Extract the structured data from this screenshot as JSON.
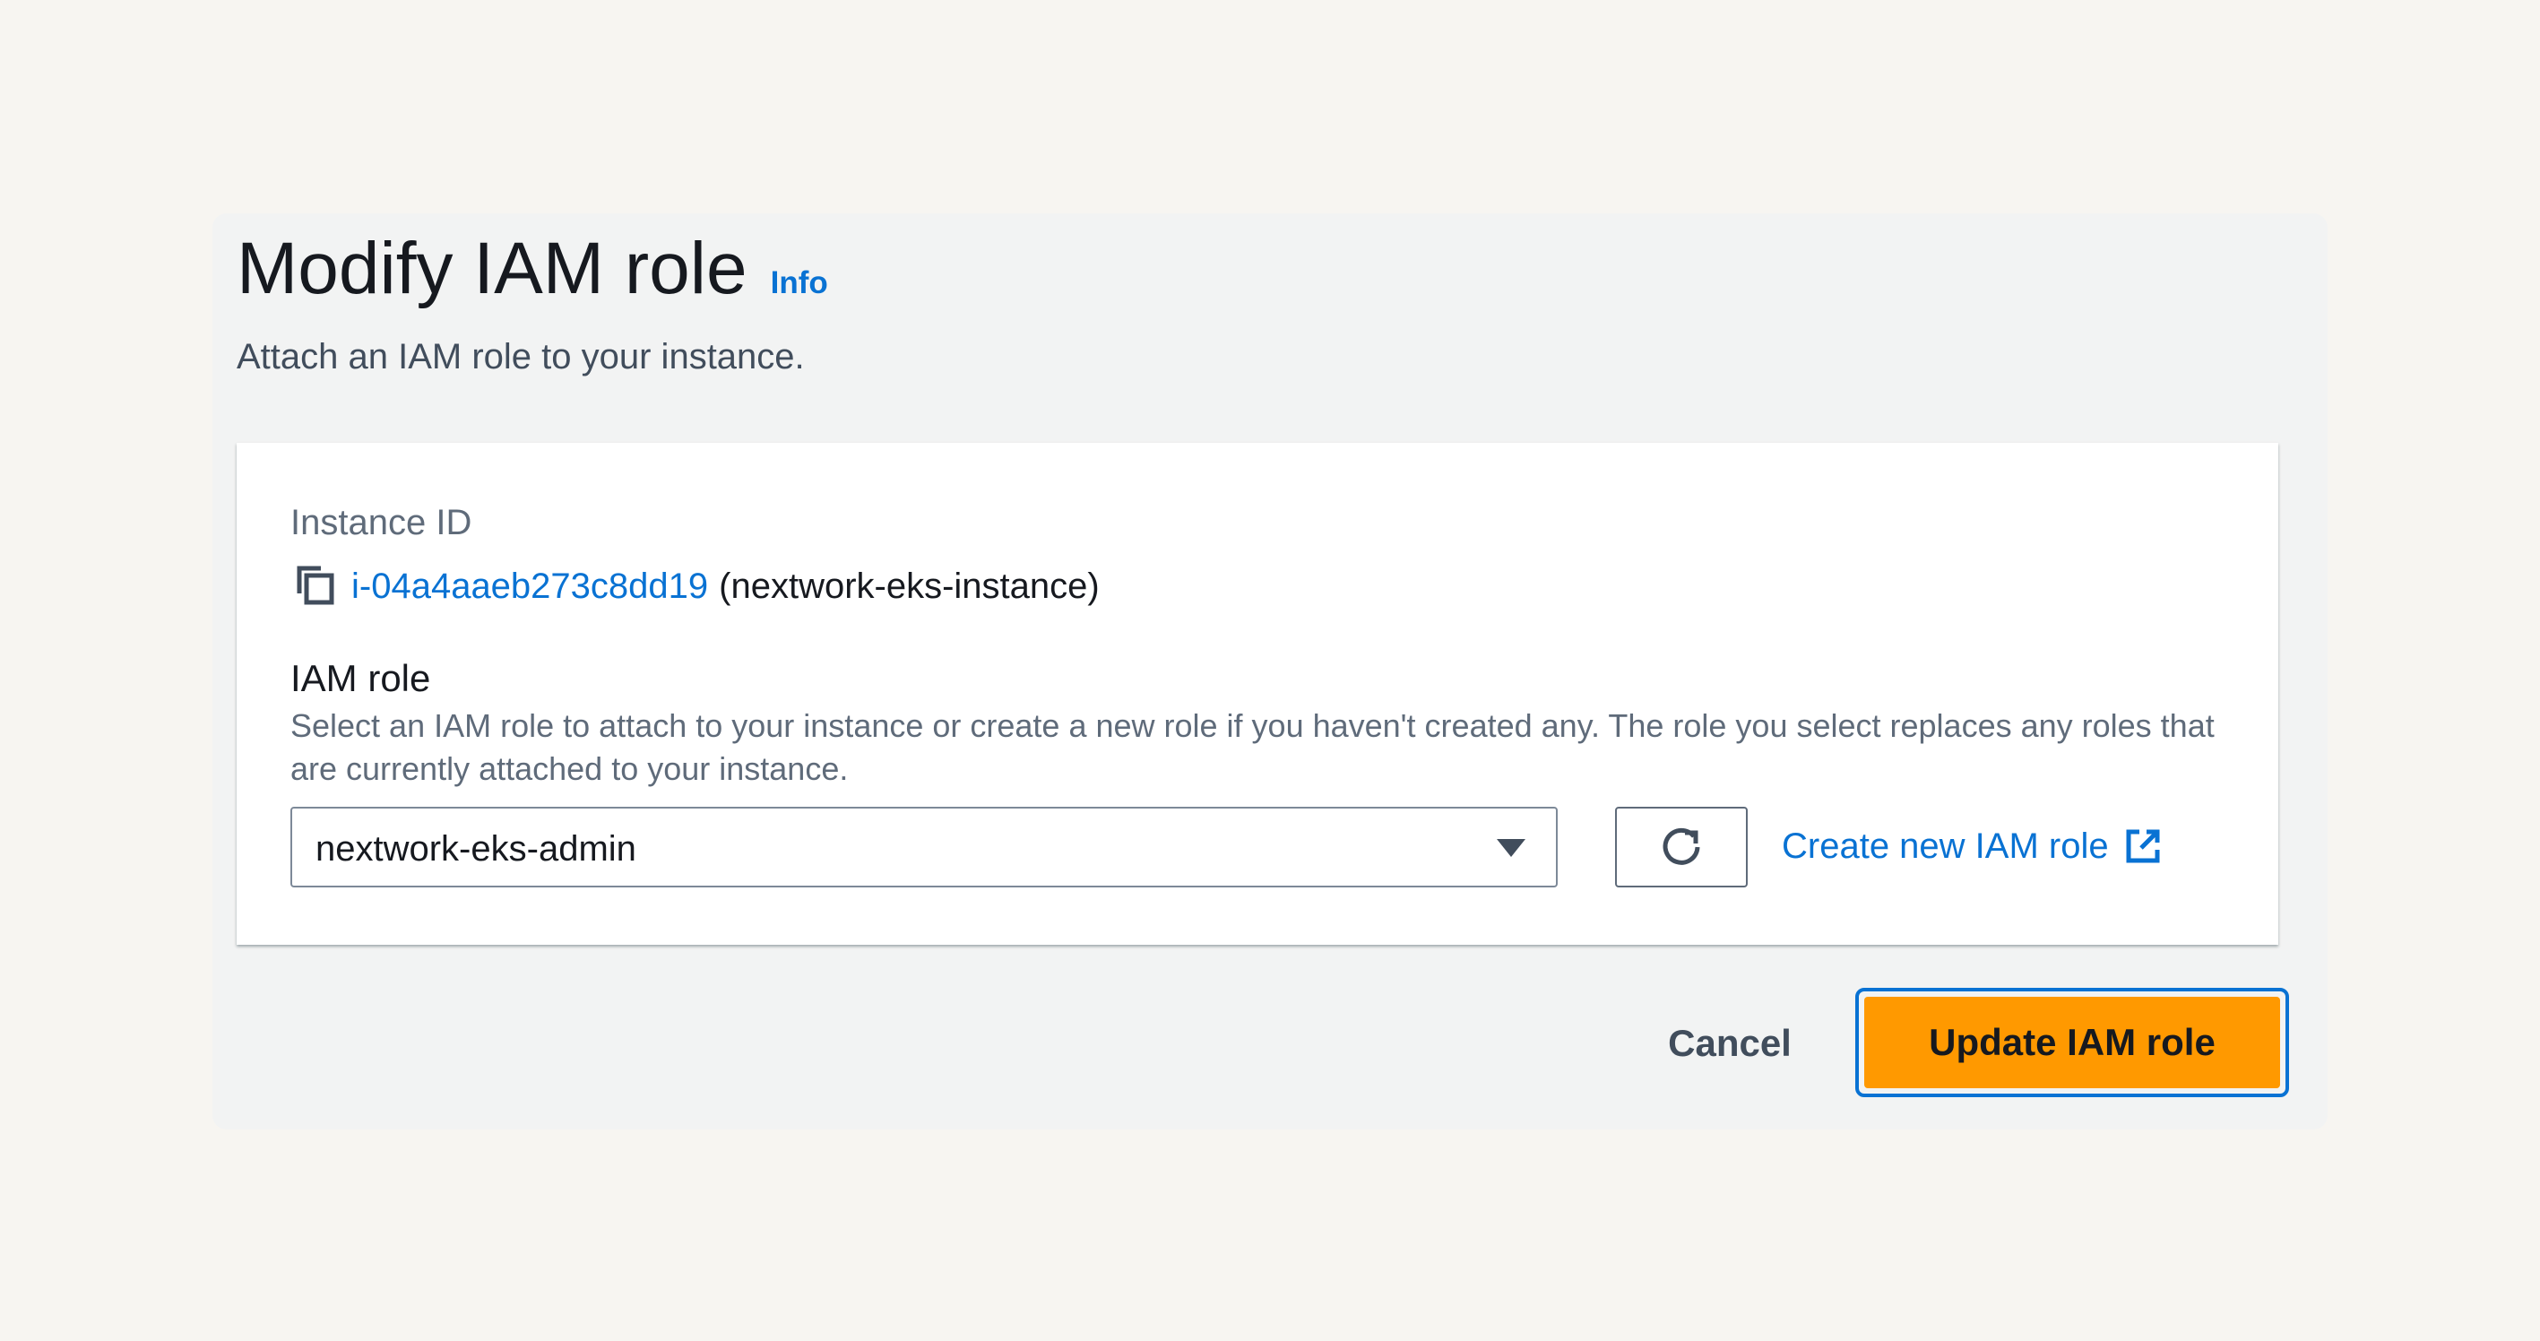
{
  "header": {
    "title": "Modify IAM role",
    "info_link": "Info",
    "subtitle": "Attach an IAM role to your instance."
  },
  "instance": {
    "label": "Instance ID",
    "id": "i-04a4aaeb273c8dd19",
    "name": "(nextwork-eks-instance)",
    "copy_icon": "copy-icon"
  },
  "iam_role": {
    "label": "IAM role",
    "description": "Select an IAM role to attach to your instance or create a new role if you haven't created any. The role you select replaces any roles that are currently attached to your instance.",
    "selected": "nextwork-eks-admin",
    "refresh_icon": "refresh-icon",
    "create_link": "Create new IAM role",
    "external_icon": "external-link-icon"
  },
  "actions": {
    "cancel": "Cancel",
    "submit": "Update IAM role"
  },
  "colors": {
    "accent": "#0972d3",
    "primary_button": "#ff9900",
    "background": "#f7f5f1",
    "panel": "#f2f3f3"
  }
}
